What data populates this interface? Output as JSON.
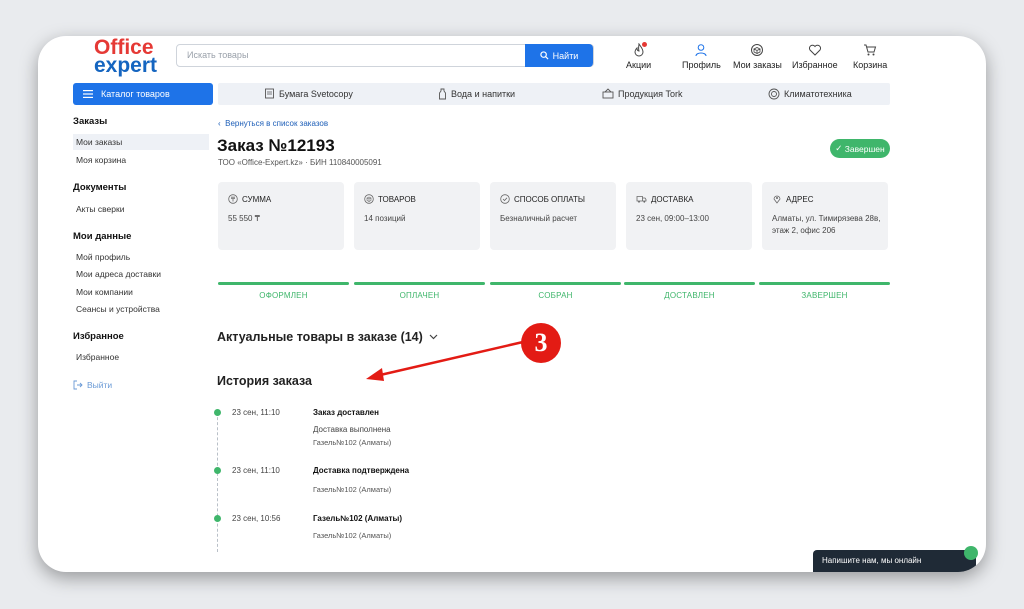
{
  "header": {
    "logo_line1": "Office",
    "logo_line2": "expert",
    "search_placeholder": "Искать товары",
    "search_button": "Найти",
    "nav": [
      {
        "label": "Акции",
        "icon": "fire-icon"
      },
      {
        "label": "Профиль",
        "icon": "user-icon"
      },
      {
        "label": "Мои заказы",
        "icon": "box-icon"
      },
      {
        "label": "Избранное",
        "icon": "heart-icon"
      },
      {
        "label": "Корзина",
        "icon": "cart-icon"
      }
    ]
  },
  "catalog": {
    "button": "Каталог товаров",
    "items": [
      "Бумага Svetocopy",
      "Вода и напитки",
      "Продукция Tork",
      "Климатотехника"
    ]
  },
  "sidebar": {
    "sections": [
      {
        "title": "Заказы",
        "items": [
          "Мои заказы",
          "Моя корзина"
        ]
      },
      {
        "title": "Документы",
        "items": [
          "Акты сверки"
        ]
      },
      {
        "title": "Мои данные",
        "items": [
          "Мой профиль",
          "Мои адреса доставки",
          "Мои компании",
          "Сеансы и устройства"
        ]
      },
      {
        "title": "Избранное",
        "items": [
          "Избранное"
        ]
      }
    ],
    "logout": "Выйти"
  },
  "order": {
    "back_link": "Вернуться в список заказов",
    "title": "Заказ №12193",
    "company": "ТОО «Office-Expert.kz» · БИН 110840005091",
    "status": "Завершен",
    "cards": [
      {
        "label": "СУММА",
        "value": "55 550 ₸",
        "icon": "tenge-icon"
      },
      {
        "label": "ТОВАРОВ",
        "value": "14 позиций",
        "icon": "box-icon"
      },
      {
        "label": "СПОСОБ ОПЛАТЫ",
        "value": "Безналичный расчет",
        "icon": "check-circle-icon"
      },
      {
        "label": "ДОСТАВКА",
        "value": "23 сен, 09:00–13:00",
        "icon": "truck-icon"
      },
      {
        "label": "АДРЕС",
        "value": "Алматы, ул. Тимирязева 28в, этаж 2, офис 206",
        "icon": "location-icon"
      }
    ],
    "steps": [
      "ОФОРМЛЕН",
      "ОПЛАЧЕН",
      "СОБРАН",
      "ДОСТАВЛЕН",
      "ЗАВЕРШЕН"
    ],
    "actual_items": "Актуальные товары в заказе (14)",
    "history_title": "История заказа",
    "annotation_number": "3",
    "history": [
      {
        "time": "23 сен, 11:10",
        "title": "Заказ доставлен",
        "text": "Доставка выполнена",
        "sub": "Газель№102 (Алматы)"
      },
      {
        "time": "23 сен, 11:10",
        "title": "Доставка подтверждена",
        "text": "",
        "sub": "Газель№102 (Алматы)"
      },
      {
        "time": "23 сен, 10:56",
        "title": "Газель№102 (Алматы)",
        "text": "",
        "sub": "Газель№102 (Алматы)"
      }
    ]
  },
  "chat": {
    "label": "Напишите нам, мы онлайн"
  },
  "colors": {
    "accent": "#1e73e8",
    "success": "#3fb66b",
    "logo_red": "#e53935",
    "logo_blue": "#1565c0",
    "annotation": "#e31b14"
  }
}
